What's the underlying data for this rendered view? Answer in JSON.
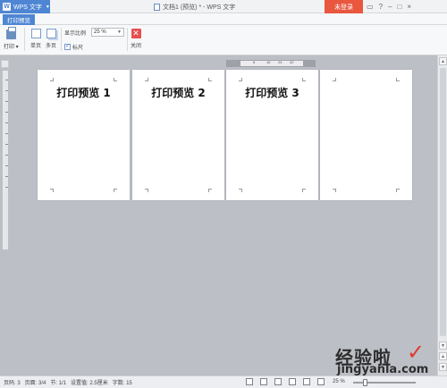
{
  "app": {
    "name": "WPS 文字",
    "logo_letter": "W"
  },
  "window": {
    "title": "文档1 (预览) * - WPS 文字",
    "login_label": "未登录",
    "controls": [
      "▭",
      "?",
      "–",
      "□",
      "×"
    ]
  },
  "tabs": [
    {
      "label": "打印预览"
    }
  ],
  "ribbon": {
    "print_label": "打印 ▾",
    "single_page_label": "单页",
    "multi_page_label": "多页",
    "zoom_label": "显示比例",
    "zoom_value": "25 %",
    "ruler_label": "标尺",
    "ruler_checked_mark": "✓",
    "close_label": "关闭",
    "close_glyph": "✕"
  },
  "ruler_marks": [
    "8",
    "16",
    "24",
    "32"
  ],
  "pages": [
    {
      "title": "打印预览 1"
    },
    {
      "title": "打印预览 2"
    },
    {
      "title": "打印预览 3"
    },
    {
      "title": ""
    }
  ],
  "statusbar": {
    "page": "页码: 3",
    "pages": "页面: 3/4",
    "section": "节: 1/1",
    "position": "设置值: 2.5厘米",
    "words": "字数: 15",
    "zoom": "25 %"
  },
  "watermark": {
    "line1": "经验啦",
    "line2": "jingyanla.com"
  },
  "colors": {
    "accent": "#4f86d3",
    "login": "#e9573f",
    "close": "#e45050"
  }
}
